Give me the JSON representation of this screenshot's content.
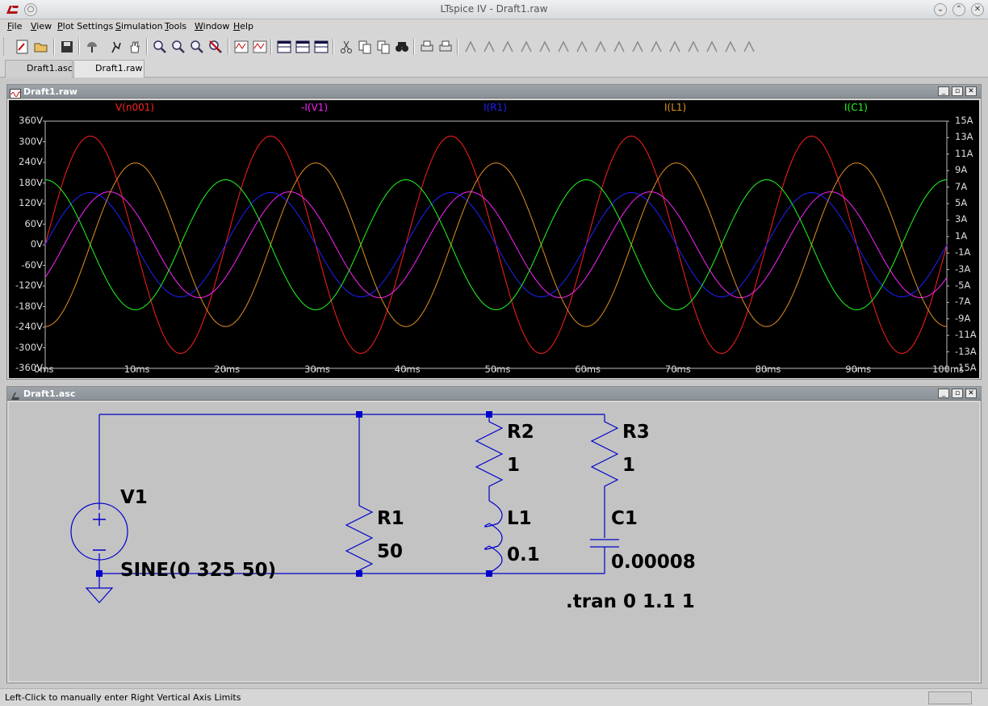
{
  "window": {
    "title": "LTspice IV - Draft1.raw"
  },
  "menu": [
    "File",
    "View",
    "Plot Settings",
    "Simulation",
    "Tools",
    "Window",
    "Help"
  ],
  "toolbar": {
    "icons": [
      "new-schematic-icon",
      "open-icon",
      "save-icon",
      "control-panel-icon",
      "run-icon",
      "pan-hand-icon",
      "zoom-in-icon",
      "zoom-out-icon",
      "zoom-fit-icon",
      "zoom-cancel-icon",
      "autorange-icon",
      "mark-icon",
      "tile-horizontal-icon",
      "cascade-icon",
      "tile-vertical-icon",
      "cut-icon",
      "copy-icon",
      "paste-icon",
      "find-icon",
      "print-setup-icon",
      "print-icon",
      "wire-icon",
      "ground-icon",
      "label-icon",
      "resistor-icon",
      "capacitor-icon",
      "inductor-icon",
      "diode-icon",
      "component-icon",
      "move-icon",
      "drag-icon",
      "undo-icon",
      "redo-icon",
      "rotate-icon",
      "mirror-icon",
      "text-icon",
      "spice-directive-icon"
    ]
  },
  "tabs": [
    {
      "label": "Draft1.asc",
      "active": false
    },
    {
      "label": "Draft1.raw",
      "active": true
    }
  ],
  "waveform_window": {
    "title": "Draft1.raw",
    "traces": [
      {
        "name": "V(n001)",
        "color": "#ff2020"
      },
      {
        "name": "-I(V1)",
        "color": "#ff20ff"
      },
      {
        "name": "I(R1)",
        "color": "#2020ff"
      },
      {
        "name": "I(L1)",
        "color": "#e09020"
      },
      {
        "name": "I(C1)",
        "color": "#20ff20"
      }
    ]
  },
  "chart_data": {
    "type": "line",
    "title": "",
    "x_tick_labels": [
      "0ms",
      "10ms",
      "20ms",
      "30ms",
      "40ms",
      "50ms",
      "60ms",
      "70ms",
      "80ms",
      "90ms",
      "100ms"
    ],
    "y_left_tick_labels": [
      "360V",
      "300V",
      "240V",
      "180V",
      "120V",
      "60V",
      "0V",
      "-60V",
      "-120V",
      "-180V",
      "-240V",
      "-300V",
      "-360V"
    ],
    "y_right_tick_labels": [
      "15A",
      "13A",
      "11A",
      "9A",
      "7A",
      "5A",
      "3A",
      "1A",
      "-1A",
      "-3A",
      "-5A",
      "-7A",
      "-9A",
      "-11A",
      "-13A",
      "-15A"
    ],
    "xlim": [
      0,
      100
    ],
    "ylim_left": [
      -360,
      360
    ],
    "ylim_right": [
      -15,
      15
    ],
    "grid": false,
    "series": [
      {
        "name": "V(n001)",
        "axis": "left",
        "unit": "V",
        "amplitude": 325,
        "frequency_hz": 50,
        "phase_deg": 0
      },
      {
        "name": "-I(V1)",
        "axis": "right",
        "unit": "A",
        "amplitude": 6.6,
        "frequency_hz": 50,
        "phase_deg": -38
      },
      {
        "name": "I(R1)",
        "axis": "right",
        "unit": "A",
        "amplitude": 6.5,
        "frequency_hz": 50,
        "phase_deg": 0
      },
      {
        "name": "I(L1)",
        "axis": "right",
        "unit": "A",
        "amplitude": 10.2,
        "frequency_hz": 50,
        "phase_deg": -90
      },
      {
        "name": "I(C1)",
        "axis": "right",
        "unit": "A",
        "amplitude": 8.1,
        "frequency_hz": 50,
        "phase_deg": 90
      }
    ]
  },
  "schematic_window": {
    "title": "Draft1.asc",
    "components": {
      "v1": {
        "ref": "V1",
        "value": "SINE(0 325 50)"
      },
      "r1": {
        "ref": "R1",
        "value": "50"
      },
      "r2": {
        "ref": "R2",
        "value": "1"
      },
      "r3": {
        "ref": "R3",
        "value": "1"
      },
      "l1": {
        "ref": "L1",
        "value": "0.1"
      },
      "c1": {
        "ref": "C1",
        "value": "0.00008"
      }
    },
    "directive": ".tran 0 1.1 1",
    "wire_color": "#0000cc"
  },
  "status": {
    "text": "Left-Click to manually enter Right Vertical Axis Limits"
  }
}
